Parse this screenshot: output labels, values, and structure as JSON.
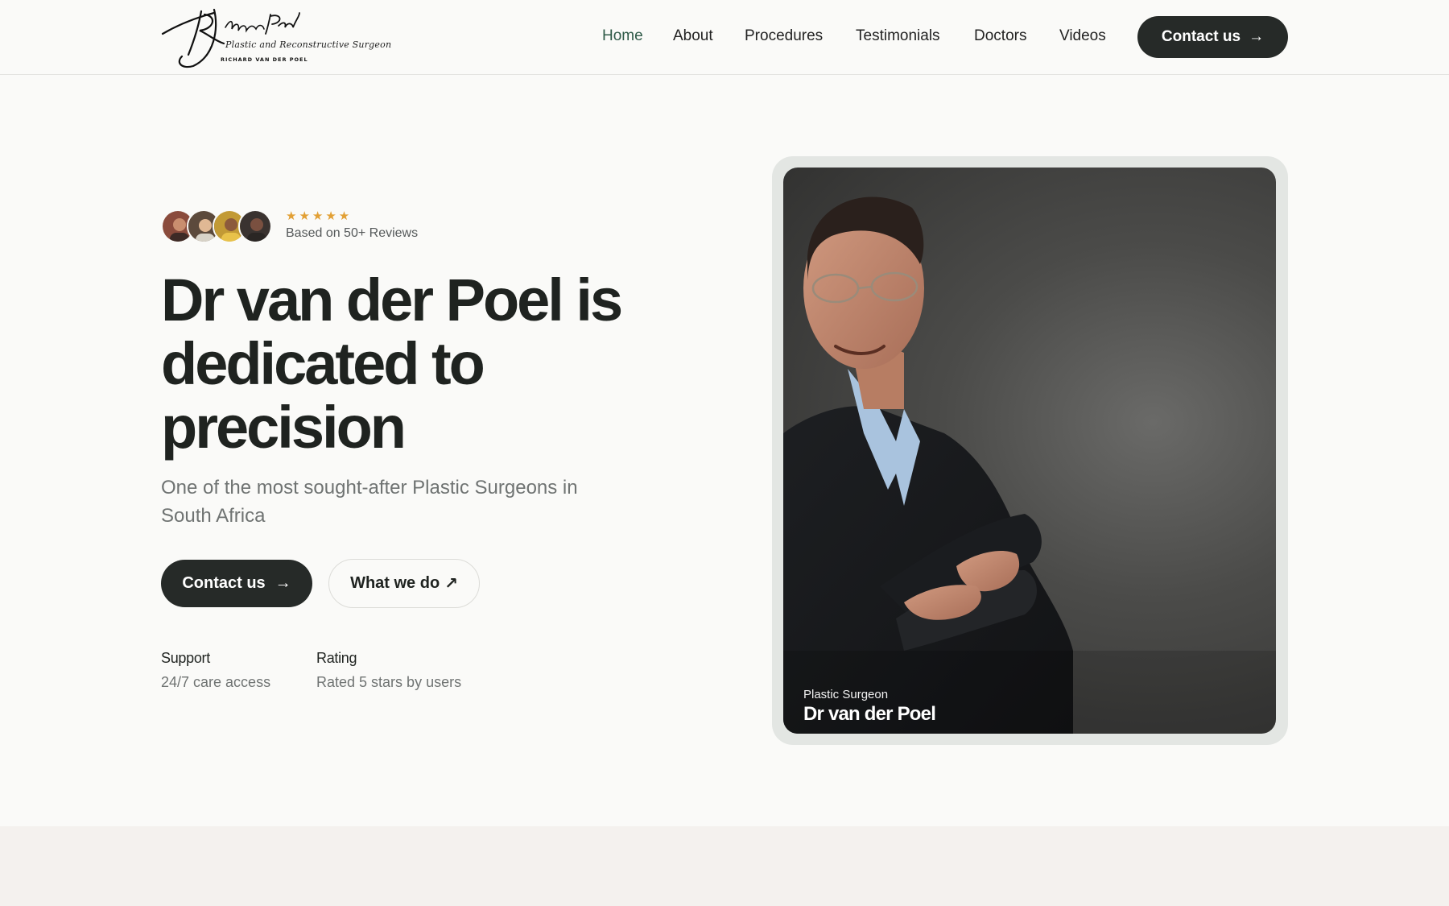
{
  "header": {
    "logo": {
      "signature": "Richard van der Poel",
      "subtitle": "Plastic and Reconstructive Surgeon",
      "name": "RICHARD VAN DER POEL"
    },
    "nav": [
      {
        "label": "Home",
        "active": true
      },
      {
        "label": "About",
        "active": false
      },
      {
        "label": "Procedures",
        "active": false
      },
      {
        "label": "Testimonials",
        "active": false
      },
      {
        "label": "Doctors",
        "active": false
      },
      {
        "label": "Videos",
        "active": false
      }
    ],
    "cta_label": "Contact us"
  },
  "hero": {
    "rating": {
      "stars": "★★★★★",
      "text": "Based on 50+ Reviews"
    },
    "headline": "Dr van der Poel is dedicated to precision",
    "subhead": "One of the most sought-after Plastic Surgeons in South Africa",
    "primary_button": "Contact us",
    "secondary_button": "What we do",
    "stats": [
      {
        "label": "Support",
        "value": "24/7 care access"
      },
      {
        "label": "Rating",
        "value": "Rated 5 stars by users"
      }
    ]
  },
  "photo_card": {
    "role": "Plastic Surgeon",
    "name": "Dr van der Poel"
  },
  "icons": {
    "arrow_right": "→",
    "arrow_up_right": "↗"
  },
  "colors": {
    "accent_dark": "#262a28",
    "nav_active": "#2f5a48",
    "star": "#e2a035",
    "background": "#fafaf8"
  }
}
